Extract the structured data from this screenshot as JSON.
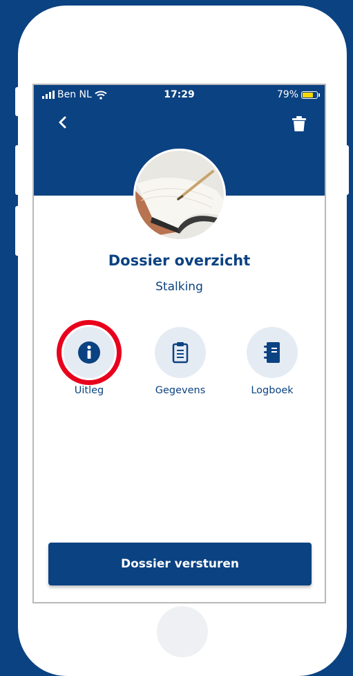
{
  "status_bar": {
    "carrier": "Ben NL",
    "time": "17:29",
    "battery": "79%",
    "battery_level": 0.79,
    "battery_color": "#f5d800"
  },
  "header": {
    "back_icon": "chevron-left-icon",
    "delete_icon": "trash-icon"
  },
  "dossier": {
    "title": "Dossier overzicht",
    "subtitle": "Stalking",
    "avatar": "notebook-photo"
  },
  "actions": [
    {
      "label": "Uitleg",
      "icon": "info-icon",
      "highlighted": true
    },
    {
      "label": "Gegevens",
      "icon": "clipboard-icon"
    },
    {
      "label": "Logboek",
      "icon": "notebook-icon"
    }
  ],
  "footer": {
    "send_label": "Dossier versturen"
  },
  "colors": {
    "brand": "#0b4282",
    "highlight": "#e8001c",
    "action_bg": "#e4ebf3"
  }
}
